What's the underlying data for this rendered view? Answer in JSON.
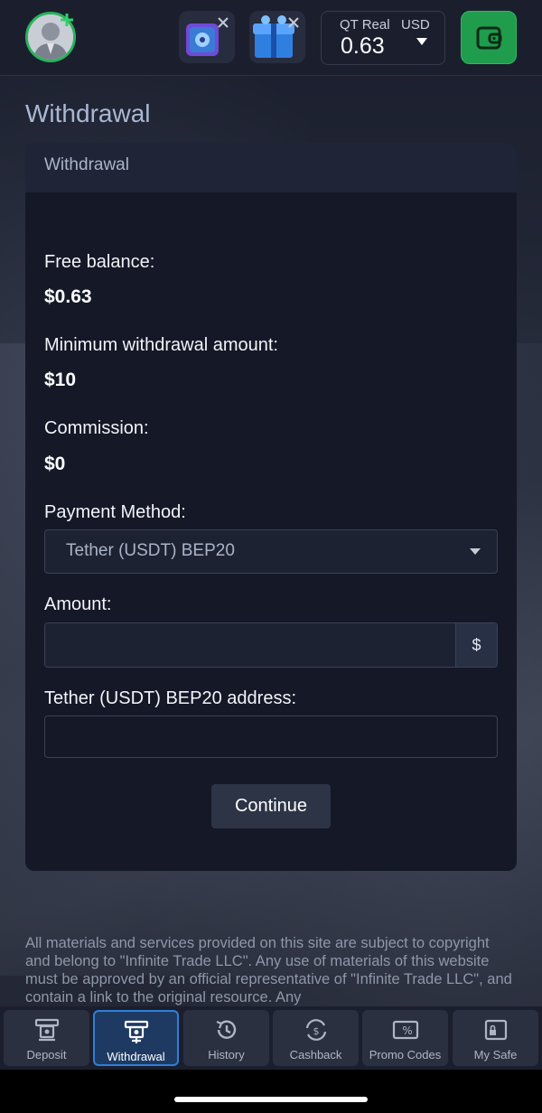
{
  "header": {
    "balance": {
      "account_type": "QT Real",
      "currency": "USD",
      "amount": "0.63"
    },
    "icons": [
      "avatar",
      "safe-promo-icon",
      "gift-promo-icon",
      "wallet-icon"
    ]
  },
  "page": {
    "title": "Withdrawal"
  },
  "card": {
    "header": "Withdrawal",
    "free_balance_label": "Free balance:",
    "free_balance_value": "$0.63",
    "min_withdrawal_label": "Minimum withdrawal amount:",
    "min_withdrawal_value": "$10",
    "commission_label": "Commission:",
    "commission_value": "$0",
    "payment_method_label": "Payment Method:",
    "payment_method_value": "Tether (USDT) BEP20",
    "amount_label": "Amount:",
    "amount_value": "",
    "amount_addon": "$",
    "address_label": "Tether (USDT) BEP20 address:",
    "address_value": "",
    "continue_label": "Continue"
  },
  "footer": {
    "text": "All materials and services provided on this site are subject to copyright and belong to \"Infinite Trade LLC\". Any use of materials of this website must be approved by an official representative of \"Infinite Trade LLC\", and contain a link to the original resource. Any"
  },
  "bottom_nav": [
    {
      "label": "Deposit",
      "icon": "deposit-icon",
      "active": false
    },
    {
      "label": "Withdrawal",
      "icon": "withdrawal-icon",
      "active": true
    },
    {
      "label": "History",
      "icon": "history-icon",
      "active": false
    },
    {
      "label": "Cashback",
      "icon": "cashback-icon",
      "active": false
    },
    {
      "label": "Promo Codes",
      "icon": "promo-codes-icon",
      "active": false
    },
    {
      "label": "My Safe",
      "icon": "my-safe-icon",
      "active": false
    }
  ],
  "colors": {
    "accent_green": "#1f9c4c",
    "active_blue": "#2f7fd8",
    "background": "#1b1f2e"
  }
}
